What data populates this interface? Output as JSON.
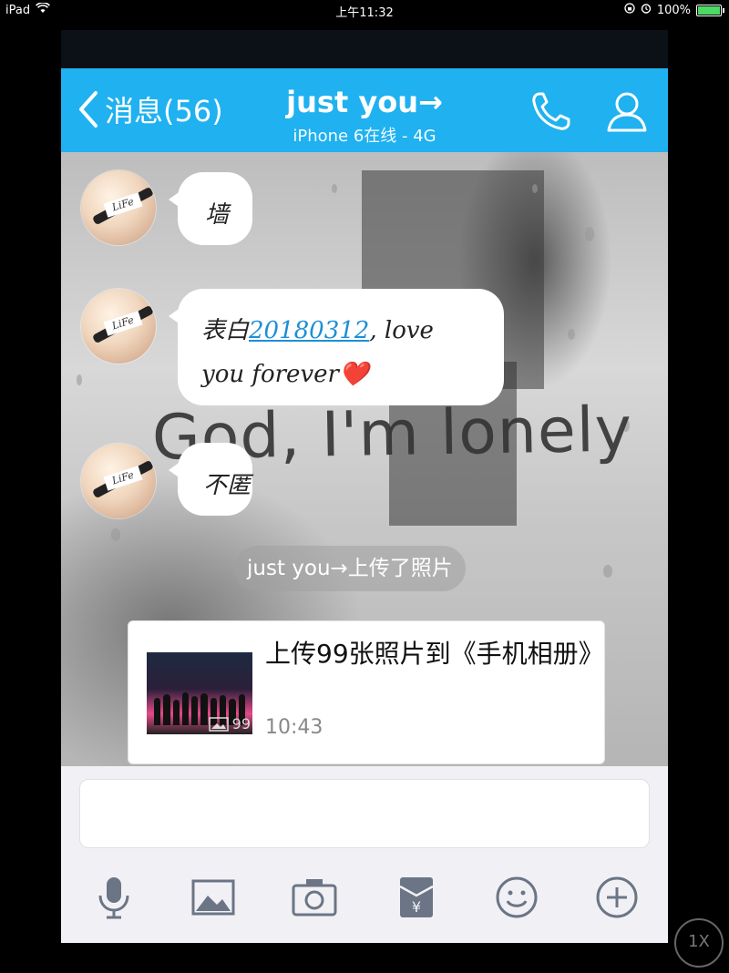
{
  "status_bar": {
    "device": "iPad",
    "time": "上午11:32",
    "battery": "100%"
  },
  "nav": {
    "back_label": "消息(56)",
    "title": "just you→",
    "subtitle": "iPhone 6在线 - 4G"
  },
  "chat": {
    "background_text": "God, I'm lonely",
    "messages": [
      {
        "text": "墙"
      },
      {
        "text_pre": "表白",
        "link": "20180312",
        "text_post": ", love you forever",
        "emoji": "❤️"
      },
      {
        "text": "不匿"
      }
    ],
    "avatar_tag": "LiFe",
    "system_notice": "just you→上传了照片",
    "upload_card": {
      "title": "上传99张照片到《手机相册》",
      "time": "10:43",
      "photo_count": "99"
    }
  },
  "overlay": {
    "zoom": "1X"
  },
  "colors": {
    "nav_bg": "#1fb1f0",
    "link": "#1d8fd6"
  }
}
